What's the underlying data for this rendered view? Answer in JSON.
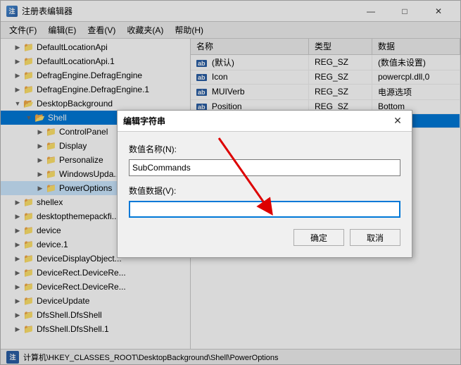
{
  "window": {
    "title": "注册表编辑器",
    "titleIcon": "reg",
    "controls": [
      "—",
      "□",
      "✕"
    ]
  },
  "menuBar": {
    "items": [
      "文件(F)",
      "编辑(E)",
      "查看(V)",
      "收藏夹(A)",
      "帮助(H)"
    ]
  },
  "tree": {
    "items": [
      {
        "id": "DefaultLocationApi",
        "label": "DefaultLocationApi",
        "indent": 1,
        "expanded": false,
        "selected": false
      },
      {
        "id": "DefaultLocationApi1",
        "label": "DefaultLocationApi.1",
        "indent": 1,
        "expanded": false,
        "selected": false
      },
      {
        "id": "DefragEngine",
        "label": "DefragEngine.DefragEngine",
        "indent": 1,
        "expanded": false,
        "selected": false
      },
      {
        "id": "DefragEngine1",
        "label": "DefragEngine.DefragEngine.1",
        "indent": 1,
        "expanded": false,
        "selected": false
      },
      {
        "id": "DesktopBackground",
        "label": "DesktopBackground",
        "indent": 1,
        "expanded": true,
        "selected": false
      },
      {
        "id": "Shell",
        "label": "Shell",
        "indent": 2,
        "expanded": true,
        "selected": true
      },
      {
        "id": "ControlPanel",
        "label": "ControlPanel",
        "indent": 3,
        "expanded": false,
        "selected": false
      },
      {
        "id": "Display",
        "label": "Display",
        "indent": 3,
        "expanded": false,
        "selected": false
      },
      {
        "id": "Personalize",
        "label": "Personalize",
        "indent": 3,
        "expanded": false,
        "selected": false
      },
      {
        "id": "WindowsUpdate",
        "label": "WindowsUpda...",
        "indent": 3,
        "expanded": false,
        "selected": false
      },
      {
        "id": "PowerOptions",
        "label": "PowerOptions",
        "indent": 3,
        "expanded": false,
        "selected": false
      },
      {
        "id": "shellex",
        "label": "shellex",
        "indent": 1,
        "expanded": false,
        "selected": false
      },
      {
        "id": "desktopthemepackfi",
        "label": "desktopthemepackfi...",
        "indent": 1,
        "expanded": false,
        "selected": false
      },
      {
        "id": "device",
        "label": "device",
        "indent": 1,
        "expanded": false,
        "selected": false
      },
      {
        "id": "device1",
        "label": "device.1",
        "indent": 1,
        "expanded": false,
        "selected": false
      },
      {
        "id": "DeviceDisplayObject",
        "label": "DeviceDisplayObject...",
        "indent": 1,
        "expanded": false,
        "selected": false
      },
      {
        "id": "DeviceRect",
        "label": "DeviceRect.DeviceRe...",
        "indent": 1,
        "expanded": false,
        "selected": false
      },
      {
        "id": "DeviceRect1",
        "label": "DeviceRect.DeviceRe...",
        "indent": 1,
        "expanded": false,
        "selected": false
      },
      {
        "id": "DeviceUpdate",
        "label": "DeviceUpdate",
        "indent": 1,
        "expanded": false,
        "selected": false
      },
      {
        "id": "DfsShell",
        "label": "DfsShell.DfsShell",
        "indent": 1,
        "expanded": false,
        "selected": false
      },
      {
        "id": "DfsShell1",
        "label": "DfsShell.DfsShell.1",
        "indent": 1,
        "expanded": false,
        "selected": false
      }
    ]
  },
  "table": {
    "columns": [
      "名称",
      "类型",
      "数据"
    ],
    "rows": [
      {
        "name": "(默认)",
        "type": "REG_SZ",
        "data": "(数值未设置)",
        "icon": "ab"
      },
      {
        "name": "Icon",
        "type": "REG_SZ",
        "data": "powercpl.dll,0",
        "icon": "ab"
      },
      {
        "name": "MUIVerb",
        "type": "REG_SZ",
        "data": "电源选项",
        "icon": "ab"
      },
      {
        "name": "Position",
        "type": "REG_SZ",
        "data": "Bottom",
        "icon": "ab"
      },
      {
        "name": "SubCommands",
        "type": "REG_SZ",
        "data": "",
        "icon": "ab",
        "selected": true,
        "outlined": true
      }
    ]
  },
  "dialog": {
    "title": "编辑字符串",
    "nameLabel": "数值名称(N):",
    "nameValue": "SubCommands",
    "dataLabel": "数值数据(V):",
    "dataValue": "",
    "okButton": "确定",
    "cancelButton": "取消"
  },
  "statusBar": {
    "text": "计算机\\HKEY_CLASSES_ROOT\\DesktopBackground\\Shell\\PowerOptions"
  }
}
